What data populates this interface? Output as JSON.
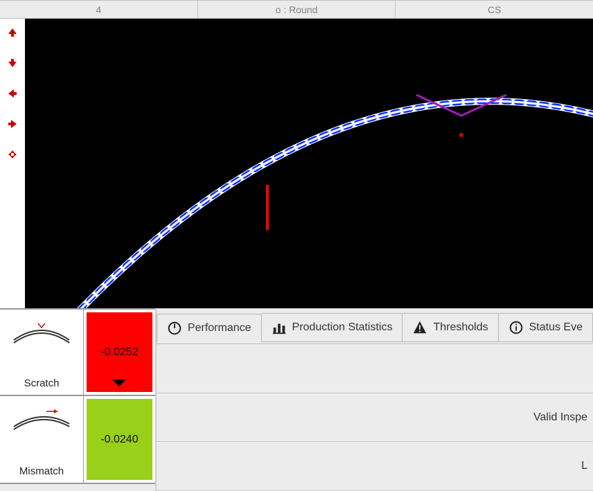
{
  "header": {
    "col1": "4",
    "col2": "o : Round",
    "col3": "CS"
  },
  "defects": [
    {
      "label": "Scratch",
      "value": "-0.0252",
      "status": "red",
      "show_arrow": true
    },
    {
      "label": "Mismatch",
      "value": "-0.0240",
      "status": "green",
      "show_arrow": false
    }
  ],
  "tabs": {
    "performance": "Performance",
    "production": "Production Statistics",
    "thresholds": "Thresholds",
    "status": "Status Eve"
  },
  "content_rows": [
    "",
    "Valid Inspe",
    "L"
  ]
}
